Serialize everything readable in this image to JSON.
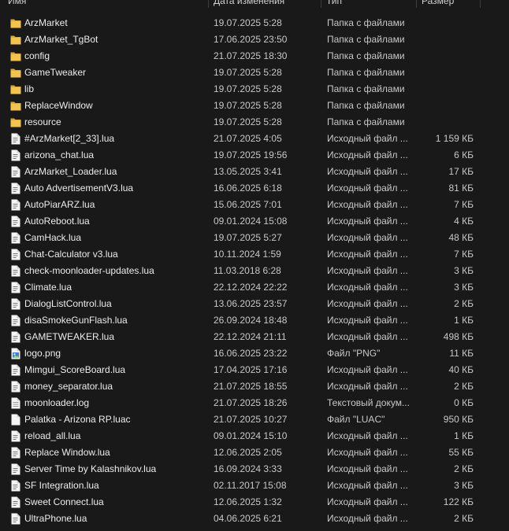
{
  "columns": {
    "name": "Имя",
    "date": "Дата изменения",
    "type": "Тип",
    "size": "Размер"
  },
  "colors": {
    "background": "#191919",
    "folder": "#f2c44e",
    "text": "#ececec"
  },
  "rows": [
    {
      "name": "ArzMarket",
      "date": "19.07.2025 5:28",
      "type": "Папка с файлами",
      "size": "",
      "icon": "folder-icon"
    },
    {
      "name": "ArzMarket_TgBot",
      "date": "17.06.2025 23:50",
      "type": "Папка с файлами",
      "size": "",
      "icon": "folder-icon"
    },
    {
      "name": "config",
      "date": "21.07.2025 18:30",
      "type": "Папка с файлами",
      "size": "",
      "icon": "folder-icon"
    },
    {
      "name": "GameTweaker",
      "date": "19.07.2025 5:28",
      "type": "Папка с файлами",
      "size": "",
      "icon": "folder-icon"
    },
    {
      "name": "lib",
      "date": "19.07.2025 5:28",
      "type": "Папка с файлами",
      "size": "",
      "icon": "folder-icon"
    },
    {
      "name": "ReplaceWindow",
      "date": "19.07.2025 5:28",
      "type": "Папка с файлами",
      "size": "",
      "icon": "folder-icon"
    },
    {
      "name": "resource",
      "date": "19.07.2025 5:28",
      "type": "Папка с файлами",
      "size": "",
      "icon": "folder-icon"
    },
    {
      "name": "#ArzMarket[2_33].lua",
      "date": "21.07.2025 4:05",
      "type": "Исходный файл ...",
      "size": "1 159 КБ",
      "icon": "file-icon"
    },
    {
      "name": "arizona_chat.lua",
      "date": "19.07.2025 19:56",
      "type": "Исходный файл ...",
      "size": "6 КБ",
      "icon": "file-icon"
    },
    {
      "name": "ArzMarket_Loader.lua",
      "date": "13.05.2025 3:41",
      "type": "Исходный файл ...",
      "size": "17 КБ",
      "icon": "file-icon"
    },
    {
      "name": "Auto AdvertisementV3.lua",
      "date": "16.06.2025 6:18",
      "type": "Исходный файл ...",
      "size": "81 КБ",
      "icon": "file-icon"
    },
    {
      "name": "AutoPiarARZ.lua",
      "date": "15.06.2025 7:01",
      "type": "Исходный файл ...",
      "size": "7 КБ",
      "icon": "file-icon"
    },
    {
      "name": "AutoReboot.lua",
      "date": "09.01.2024 15:08",
      "type": "Исходный файл ...",
      "size": "4 КБ",
      "icon": "file-icon"
    },
    {
      "name": "CamHack.lua",
      "date": "19.07.2025 5:27",
      "type": "Исходный файл ...",
      "size": "48 КБ",
      "icon": "file-icon"
    },
    {
      "name": "Chat-Calculator v3.lua",
      "date": "10.11.2024 1:59",
      "type": "Исходный файл ...",
      "size": "7 КБ",
      "icon": "file-icon"
    },
    {
      "name": "check-moonloader-updates.lua",
      "date": "11.03.2018 6:28",
      "type": "Исходный файл ...",
      "size": "3 КБ",
      "icon": "file-icon"
    },
    {
      "name": "Climate.lua",
      "date": "22.12.2024 22:22",
      "type": "Исходный файл ...",
      "size": "3 КБ",
      "icon": "file-icon"
    },
    {
      "name": "DialogListControl.lua",
      "date": "13.06.2025 23:57",
      "type": "Исходный файл ...",
      "size": "2 КБ",
      "icon": "file-icon"
    },
    {
      "name": "disaSmokeGunFlash.lua",
      "date": "26.09.2024 18:48",
      "type": "Исходный файл ...",
      "size": "1 КБ",
      "icon": "file-icon"
    },
    {
      "name": "GAMETWEAKER.lua",
      "date": "22.12.2024 21:11",
      "type": "Исходный файл ...",
      "size": "498 КБ",
      "icon": "file-icon"
    },
    {
      "name": "logo.png",
      "date": "16.06.2025 23:22",
      "type": "Файл \"PNG\"",
      "size": "11 КБ",
      "icon": "image-file-icon"
    },
    {
      "name": "Mimgui_ScoreBoard.lua",
      "date": "17.04.2025 17:16",
      "type": "Исходный файл ...",
      "size": "40 КБ",
      "icon": "file-icon"
    },
    {
      "name": "money_separator.lua",
      "date": "21.07.2025 18:55",
      "type": "Исходный файл ...",
      "size": "2 КБ",
      "icon": "file-icon"
    },
    {
      "name": "moonloader.log",
      "date": "21.07.2025 18:26",
      "type": "Текстовый докум...",
      "size": "0 КБ",
      "icon": "text-file-icon"
    },
    {
      "name": "Palatka - Arizona RP.luac",
      "date": "21.07.2025 10:27",
      "type": "Файл \"LUAC\"",
      "size": "950 КБ",
      "icon": "blank-file-icon"
    },
    {
      "name": "reload_all.lua",
      "date": "09.01.2024 15:10",
      "type": "Исходный файл ...",
      "size": "1 КБ",
      "icon": "file-icon"
    },
    {
      "name": "Replace Window.lua",
      "date": "12.06.2025 2:05",
      "type": "Исходный файл ...",
      "size": "55 КБ",
      "icon": "file-icon"
    },
    {
      "name": "Server Time by Kalashnikov.lua",
      "date": "16.09.2024 3:33",
      "type": "Исходный файл ...",
      "size": "2 КБ",
      "icon": "file-icon"
    },
    {
      "name": "SF Integration.lua",
      "date": "02.11.2017 15:08",
      "type": "Исходный файл ...",
      "size": "3 КБ",
      "icon": "file-icon"
    },
    {
      "name": "Sweet Connect.lua",
      "date": "12.06.2025 1:32",
      "type": "Исходный файл ...",
      "size": "122 КБ",
      "icon": "file-icon"
    },
    {
      "name": "UltraPhone.lua",
      "date": "04.06.2025 6:21",
      "type": "Исходный файл ...",
      "size": "2 КБ",
      "icon": "file-icon"
    }
  ]
}
